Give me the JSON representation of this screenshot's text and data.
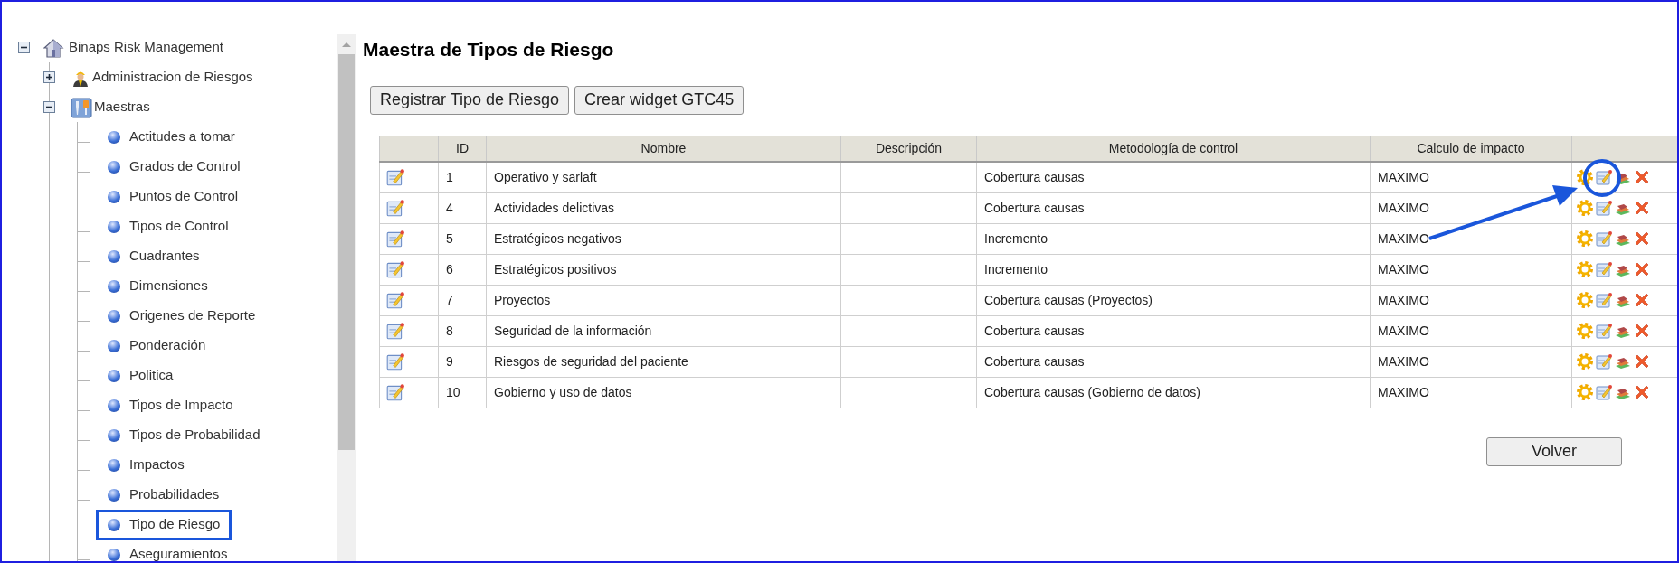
{
  "tree": {
    "label": "Binaps Risk Management",
    "kind": "house",
    "expanded": true,
    "children": [
      {
        "label": "Administracion de Riesgos",
        "kind": "worker",
        "expanded": false
      },
      {
        "label": "Maestras",
        "kind": "tools",
        "expanded": true,
        "children": [
          {
            "label": "Actitudes a tomar",
            "selected": false
          },
          {
            "label": "Grados de Control",
            "selected": false
          },
          {
            "label": "Puntos de Control",
            "selected": false
          },
          {
            "label": "Tipos de Control",
            "selected": false
          },
          {
            "label": "Cuadrantes",
            "selected": false
          },
          {
            "label": "Dimensiones",
            "selected": false
          },
          {
            "label": "Origenes de Reporte",
            "selected": false
          },
          {
            "label": "Ponderación",
            "selected": false
          },
          {
            "label": "Politica",
            "selected": false
          },
          {
            "label": "Tipos de Impacto",
            "selected": false
          },
          {
            "label": "Tipos de Probabilidad",
            "selected": false
          },
          {
            "label": "Impactos",
            "selected": false
          },
          {
            "label": "Probabilidades",
            "selected": false
          },
          {
            "label": "Tipo de Riesgo",
            "selected": true
          },
          {
            "label": "Aseguramientos",
            "selected": false
          }
        ]
      }
    ]
  },
  "title": "Maestra de Tipos de Riesgo",
  "buttons": [
    "Registrar Tipo de Riesgo",
    "Crear widget GTC45"
  ],
  "table": {
    "columns": [
      "ID",
      "Nombre",
      "Descripción",
      "Metodología de control",
      "Calculo de impacto"
    ],
    "rows": [
      {
        "id": "1",
        "nombre": "Operativo y sarlaft",
        "metodologia": "Cobertura causas",
        "calculo": "MAXIMO"
      },
      {
        "id": "4",
        "nombre": "Actividades delictivas",
        "metodologia": "Cobertura causas",
        "calculo": "MAXIMO"
      },
      {
        "id": "5",
        "nombre": "Estratégicos negativos",
        "metodologia": "Incremento",
        "calculo": "MAXIMO"
      },
      {
        "id": "6",
        "nombre": "Estratégicos positivos",
        "metodologia": "Incremento",
        "calculo": "MAXIMO"
      },
      {
        "id": "7",
        "nombre": "Proyectos",
        "metodologia": "Cobertura causas (Proyectos)",
        "calculo": "MAXIMO"
      },
      {
        "id": "8",
        "nombre": "Seguridad de la información",
        "metodologia": "Cobertura causas",
        "calculo": "MAXIMO"
      },
      {
        "id": "9",
        "nombre": "Riesgos de seguridad del paciente",
        "metodologia": "Cobertura causas",
        "calculo": "MAXIMO"
      },
      {
        "id": "10",
        "nombre": "Gobierno y uso de datos",
        "metodologia": "Cobertura causas (Gobierno de datos)",
        "calculo": "MAXIMO"
      }
    ]
  },
  "volver_button": "Volver"
}
